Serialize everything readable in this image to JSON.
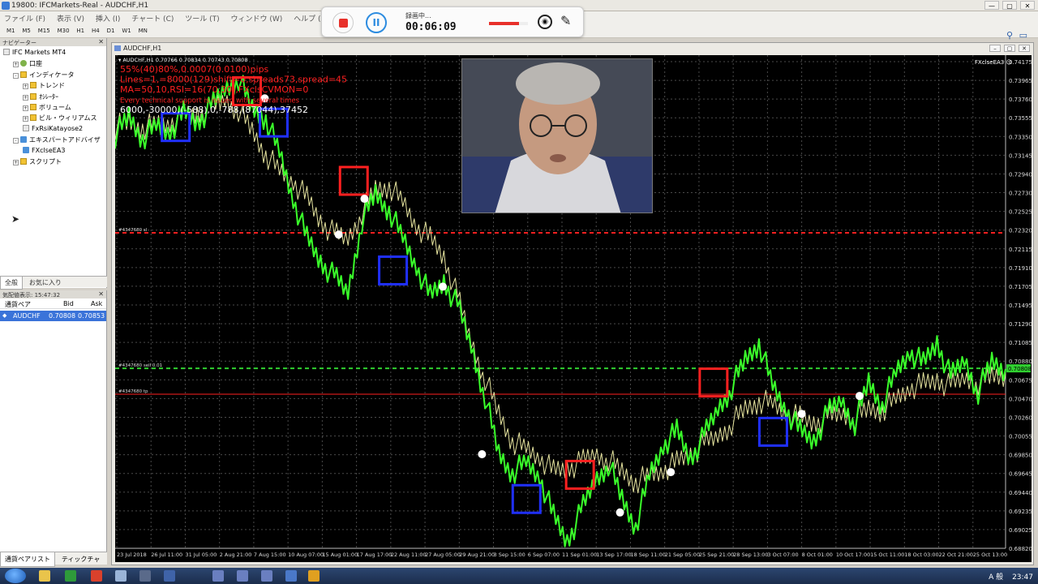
{
  "window": {
    "title": "19800: IFCMarkets-Real - AUDCHF,H1",
    "buttons": [
      "—",
      "▢",
      "✕"
    ]
  },
  "menu": [
    "ファイル (F)",
    "表示 (V)",
    "挿入 (I)",
    "チャート (C)",
    "ツール (T)",
    "ウィンドウ (W)",
    "ヘルプ (H)"
  ],
  "timeframes": [
    "M1",
    "M5",
    "M15",
    "M30",
    "H1",
    "H4",
    "D1",
    "W1",
    "MN"
  ],
  "recorder": {
    "label": "録画中...",
    "time": "00:06:09",
    "level": 0.78
  },
  "navigator": {
    "title": "ナビゲーター",
    "items": [
      {
        "label": "IFC Markets MT4",
        "icon": "terminal-icon",
        "level": 0
      },
      {
        "label": "口座",
        "icon": "account-icon",
        "level": 1,
        "expander": "+"
      },
      {
        "label": "インディケータ",
        "icon": "folder-icon",
        "level": 1,
        "expander": "-"
      },
      {
        "label": "トレンド",
        "icon": "folder-icon",
        "level": 2,
        "expander": "+"
      },
      {
        "label": "ｵｼﾚｰﾀｰ",
        "icon": "folder-icon",
        "level": 2,
        "expander": "+"
      },
      {
        "label": "ボリューム",
        "icon": "folder-icon",
        "level": 2,
        "expander": "+"
      },
      {
        "label": "ビル・ウィリアムス",
        "icon": "folder-icon",
        "level": 2,
        "expander": "+"
      },
      {
        "label": "FxRsiKatayose2",
        "icon": "indicator-file-icon",
        "level": 2
      },
      {
        "label": "エキスパートアドバイザ",
        "icon": "expert-icon",
        "level": 1,
        "expander": "-"
      },
      {
        "label": "FXclseEA3",
        "icon": "expert-icon",
        "level": 2
      },
      {
        "label": "スクリプト",
        "icon": "folder-icon",
        "level": 1,
        "expander": "+"
      }
    ],
    "tabs": [
      "全般",
      "お気に入り"
    ]
  },
  "market_watch": {
    "title": "気配値表示: 15:47:32",
    "columns": [
      "通貨ペア",
      "Bid",
      "Ask"
    ],
    "rows": [
      {
        "symbol": "AUDCHF",
        "bid": "0.70808",
        "ask": "0.70853"
      }
    ],
    "tabs": [
      "通貨ペアリスト",
      "ティックチャ"
    ]
  },
  "chart": {
    "window_title": "AUDCHF,H1",
    "header": "AUDCHF,H1  0.70766 0.70834 0.70743 0.70808",
    "ea_label": "FXclseEA3 ☺",
    "overlay_lines": [
      {
        "text": "55%(40)80%,0.0007(0.0100)pips",
        "color": "#ff2020"
      },
      {
        "text": "Lines=1,=8000(129)shift=0,spreads73,spread=45",
        "color": "#ff2020"
      },
      {
        "text": "MA=50,10,RSI=16(70,30),FXclsCVMON=0",
        "color": "#ff2020"
      },
      {
        "text": "Every technical support is issued with several times",
        "color": "#ff2020"
      },
      {
        "text": "6000,-30000,(-588),0,-788,(87044),37452",
        "color": "#ffffff"
      }
    ],
    "hlines": [
      {
        "label": "#4347680 sl",
        "price": 0.7232,
        "color": "#ff2020",
        "style": "dash"
      },
      {
        "label": "#4347680 sell 0.01",
        "price": 0.70808,
        "color": "#30d030",
        "style": "dash"
      },
      {
        "label": "#4347680 tp",
        "price": 0.7052,
        "color": "#ff2020",
        "style": "solid"
      }
    ],
    "price_labels": [
      "0.74175",
      "0.73965",
      "0.73760",
      "0.73555",
      "0.73350",
      "0.73145",
      "0.72940",
      "0.72730",
      "0.72525",
      "0.72320",
      "0.72115",
      "0.71910",
      "0.71705",
      "0.71495",
      "0.71290",
      "0.71085",
      "0.70880",
      "0.70675",
      "0.70470",
      "0.70260",
      "0.70055",
      "0.69850",
      "0.69645",
      "0.69440",
      "0.69235",
      "0.69025",
      "0.68820"
    ],
    "current_price": "0.70808",
    "date_labels": [
      "23 Jul 2018",
      "26 Jul 11:00",
      "31 Jul 05:00",
      "2 Aug 21:00",
      "7 Aug 15:00",
      "10 Aug 07:00",
      "15 Aug 01:00",
      "17 Aug 17:00",
      "22 Aug 11:00",
      "27 Aug 05:00",
      "29 Aug 21:00",
      "3 Sep 15:00",
      "6 Sep 07:00",
      "11 Sep 01:00",
      "13 Sep 17:00",
      "18 Sep 11:00",
      "21 Sep 05:00",
      "25 Sep 21:00",
      "28 Sep 13:00",
      "3 Oct 07:00",
      "8 Oct 01:00",
      "10 Oct 17:00",
      "15 Oct 11:00",
      "18 Oct 03:00",
      "22 Oct 21:00",
      "25 Oct 13:00"
    ],
    "price_series": [
      0.734,
      0.7362,
      0.7338,
      0.735,
      0.7345,
      0.7365,
      0.7355,
      0.7372,
      0.7392,
      0.7405,
      0.737,
      0.736,
      0.732,
      0.727,
      0.7225,
      0.72,
      0.7182,
      0.7165,
      0.7245,
      0.7275,
      0.7258,
      0.7225,
      0.7195,
      0.716,
      0.7178,
      0.715,
      0.7105,
      0.705,
      0.6985,
      0.6965,
      0.6975,
      0.696,
      0.6915,
      0.6888,
      0.692,
      0.6955,
      0.6975,
      0.6935,
      0.6905,
      0.696,
      0.6995,
      0.701,
      0.698,
      0.7005,
      0.7035,
      0.706,
      0.709,
      0.711,
      0.706,
      0.7035,
      0.701,
      0.7,
      0.703,
      0.7045,
      0.702,
      0.7065,
      0.704,
      0.7075,
      0.71,
      0.7085,
      0.711,
      0.707,
      0.709,
      0.7055,
      0.7088,
      0.708
    ],
    "ma_series": [
      0.735,
      0.7355,
      0.735,
      0.7352,
      0.7355,
      0.7362,
      0.7365,
      0.737,
      0.738,
      0.737,
      0.7345,
      0.732,
      0.73,
      0.729,
      0.727,
      0.7245,
      0.723,
      0.7225,
      0.7255,
      0.728,
      0.7285,
      0.7265,
      0.724,
      0.7225,
      0.7205,
      0.716,
      0.711,
      0.707,
      0.703,
      0.7,
      0.699,
      0.6982,
      0.6965,
      0.697,
      0.6975,
      0.6985,
      0.698,
      0.6965,
      0.6955,
      0.696,
      0.6968,
      0.6975,
      0.6985,
      0.6995,
      0.7005,
      0.702,
      0.7035,
      0.7045,
      0.704,
      0.703,
      0.7025,
      0.702,
      0.7025,
      0.703,
      0.7025,
      0.7035,
      0.7035,
      0.7045,
      0.706,
      0.7062,
      0.7068,
      0.706,
      0.707,
      0.7065,
      0.7072,
      0.7075
    ],
    "markers": [
      {
        "type": "box",
        "color": "#ff2020",
        "x": 0.148,
        "price": 0.739
      },
      {
        "type": "box",
        "color": "#2030ff",
        "x": 0.068,
        "price": 0.735
      },
      {
        "type": "box",
        "color": "#2030ff",
        "x": 0.178,
        "price": 0.7355
      },
      {
        "type": "box",
        "color": "#ff2020",
        "x": 0.268,
        "price": 0.729
      },
      {
        "type": "box",
        "color": "#2030ff",
        "x": 0.312,
        "price": 0.719
      },
      {
        "type": "box",
        "color": "#2030ff",
        "x": 0.462,
        "price": 0.6935
      },
      {
        "type": "box",
        "color": "#ff2020",
        "x": 0.522,
        "price": 0.6962
      },
      {
        "type": "box",
        "color": "#ff2020",
        "x": 0.672,
        "price": 0.7065
      },
      {
        "type": "box",
        "color": "#2030ff",
        "x": 0.739,
        "price": 0.701
      },
      {
        "type": "dot",
        "color": "#ffffff",
        "x": 0.168,
        "price": 0.7382
      },
      {
        "type": "dot",
        "color": "#ffffff",
        "x": 0.28,
        "price": 0.727
      },
      {
        "type": "dot",
        "color": "#ffffff",
        "x": 0.251,
        "price": 0.723
      },
      {
        "type": "dot",
        "color": "#ffffff",
        "x": 0.368,
        "price": 0.7172
      },
      {
        "type": "dot",
        "color": "#ffffff",
        "x": 0.412,
        "price": 0.6985
      },
      {
        "type": "dot",
        "color": "#ffffff",
        "x": 0.567,
        "price": 0.692
      },
      {
        "type": "dot",
        "color": "#ffffff",
        "x": 0.624,
        "price": 0.6965
      },
      {
        "type": "dot",
        "color": "#ffffff",
        "x": 0.771,
        "price": 0.703
      },
      {
        "type": "dot",
        "color": "#ffffff",
        "x": 0.836,
        "price": 0.705
      }
    ],
    "y_min": 0.688,
    "y_max": 0.7423
  },
  "taskbar": {
    "clock": "23:47",
    "ime": "A 般"
  }
}
